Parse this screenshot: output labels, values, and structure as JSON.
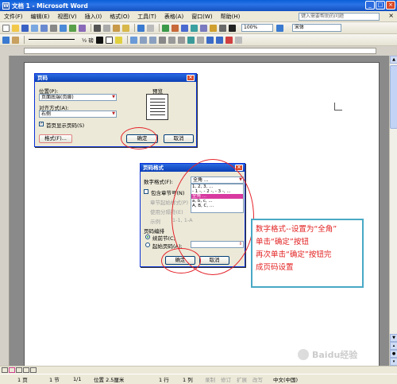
{
  "window": {
    "title": "文档 1 - Microsoft Word"
  },
  "menubar": {
    "items": [
      "文件(F)",
      "编辑(E)",
      "视图(V)",
      "插入(I)",
      "格式(O)",
      "工具(T)",
      "表格(A)",
      "窗口(W)",
      "帮助(H)"
    ],
    "help_placeholder": "键入需要帮助的问题"
  },
  "toolbar": {
    "zoom": "100%",
    "font": "宋体",
    "style_label": "½ 磅"
  },
  "statusbar": {
    "page": "1 页",
    "section": "1 节",
    "page_of": "1/1",
    "position": "位置 2.5厘米",
    "line": "1 行",
    "column": "1 列",
    "rec": "录制",
    "trk": "修订",
    "ext": "扩展",
    "ovr": "改写",
    "language": "中文(中国)"
  },
  "dialog1": {
    "title": "页码",
    "position_label": "位置(P):",
    "position_value": "页面底端(页脚)",
    "align_label": "对齐方式(A):",
    "align_value": "右侧",
    "firstpage_label": "首页显示页码(S)",
    "preview_label": "预览",
    "format_button": "格式(F)...",
    "ok_button": "确定",
    "cancel_button": "取消"
  },
  "dialog2": {
    "title": "页码格式",
    "number_format_label": "数字格式(F):",
    "number_format_value": "全角 ...",
    "include_chapter_label": "包含章节号(N)",
    "chapter_style_label": "章节起始样式(P)",
    "separator_label": "使用分隔符(E)",
    "example_label": "示例",
    "example_value": "1-1, 1-A",
    "numbering_label": "页码编排",
    "continue_label": "续前节(C)",
    "startat_label": "起始页码(A):",
    "list_items": [
      "1, 2, 3, ...",
      "- 1 -, - 2 -, - 3 -, ...",
      "全角 ...",
      "a, b, c, ...",
      "A, B, C, ..."
    ],
    "ok_button": "确定",
    "cancel_button": "取消"
  },
  "callout": {
    "lines": [
      "数字格式--设置为“全角”",
      "单击“确定”按钮",
      "再次单击“确定”按钮完",
      "成页码设置"
    ]
  },
  "watermark": {
    "text": "Baidu经验"
  }
}
